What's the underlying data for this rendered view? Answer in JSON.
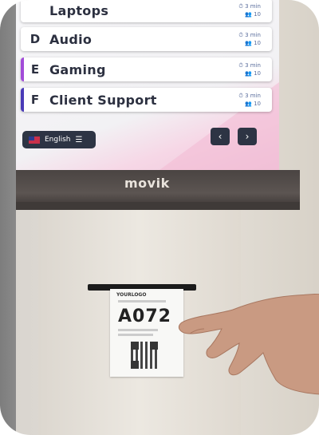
{
  "queue": {
    "items": [
      {
        "letter": "",
        "label": "Laptops",
        "time": "3 min",
        "count": "10",
        "accent": ""
      },
      {
        "letter": "D",
        "label": "Audio",
        "time": "3 min",
        "count": "10",
        "accent": ""
      },
      {
        "letter": "E",
        "label": "Gaming",
        "time": "3 min",
        "count": "10",
        "accent": "#a24cd8"
      },
      {
        "letter": "F",
        "label": "Client Support",
        "time": "3 min",
        "count": "10",
        "accent": "#4a3bb8"
      }
    ]
  },
  "language": {
    "label": "English"
  },
  "brand": {
    "name": "movik"
  },
  "ticket": {
    "logo": "YOURLOGO",
    "number": "A072"
  },
  "icons": {
    "clock": "clock-icon",
    "people": "people-icon",
    "prev": "chevron-left-icon",
    "next": "chevron-right-icon",
    "menu": "menu-icon",
    "flag": "uk-flag-icon"
  }
}
